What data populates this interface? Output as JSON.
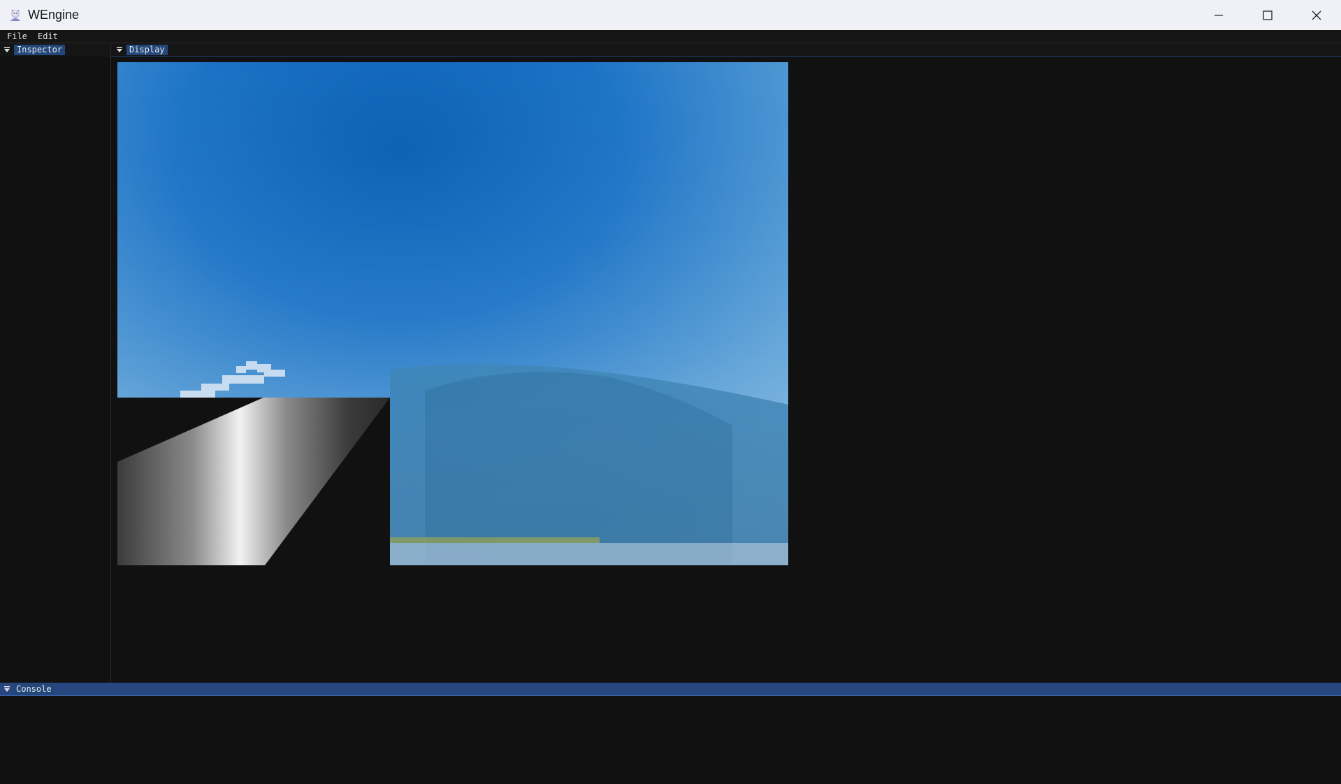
{
  "window": {
    "title": "WEngine",
    "icon": "app-logo-icon",
    "controls": [
      "minimize-icon",
      "maximize-icon",
      "close-icon"
    ]
  },
  "menu": {
    "file": "File",
    "edit": "Edit"
  },
  "panels": {
    "inspector": {
      "label": "Inspector"
    },
    "display": {
      "label": "Display"
    },
    "console": {
      "label": "Console"
    }
  },
  "colors": {
    "background": "#111111",
    "tab_active": "#24477b",
    "console_bar": "#284780",
    "titlebar": "#eff1f7"
  }
}
